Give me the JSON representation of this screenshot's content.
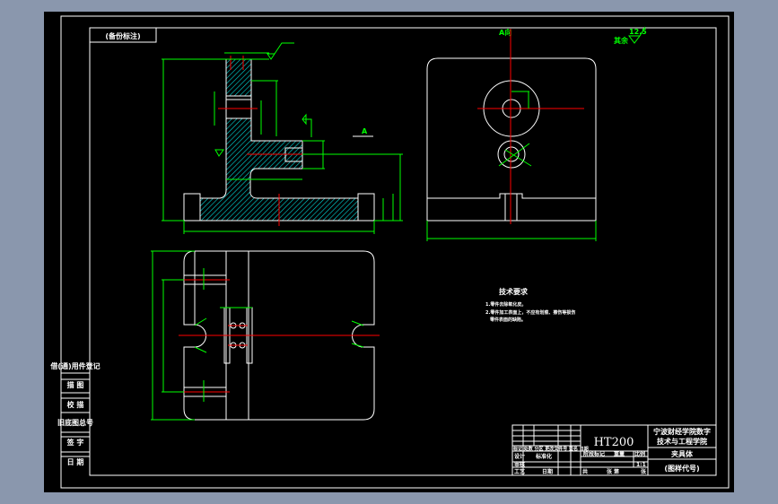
{
  "colors": {
    "background": "#8a97ad",
    "canvas": "#000000",
    "outline": "#ffffff",
    "dimension": "#00ff00",
    "centerline": "#ff0000",
    "hatch": "#00ffff"
  },
  "header_label": "(备份标注)",
  "view_labels": {
    "section_arrow": "A",
    "view_a": "A向"
  },
  "surface_finish": {
    "label": "其余",
    "value": "12.5"
  },
  "tech_requirements": {
    "title": "技术要求",
    "items": [
      "1.零件去除氧化皮。",
      "2.零件加工表面上，不应有划痕、擦伤等损伤",
      "零件表面的缺陷。"
    ]
  },
  "left_table": {
    "title": "借(通)用件登记",
    "rows": [
      "描 图",
      "校 描",
      "旧底图总号",
      "签 字",
      "日 期"
    ]
  },
  "title_block": {
    "material": "HT200",
    "school": [
      "宁波财经学院数字",
      "技术与工程学院"
    ],
    "part_name": "夹具体",
    "drawing_code": "(图样代号)",
    "change_row": "标记 处数 分区 更改文件号 签名 日期",
    "design": "设计",
    "standardization": "标准化",
    "review": "审核",
    "process": "工艺",
    "date": "日期",
    "stage_headers": [
      "阶段标记",
      "重量",
      "比例"
    ],
    "scale": "1:1",
    "sheets": [
      "共",
      "张",
      "第",
      "张"
    ]
  }
}
